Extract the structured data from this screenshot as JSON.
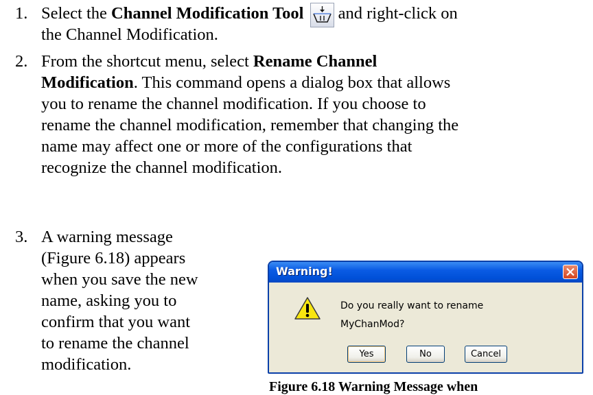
{
  "steps": [
    {
      "number": "1.",
      "pre": "Select the ",
      "bold": "Channel Modification Tool",
      "post": " and right-click on",
      "line2": "the Channel Modification.",
      "icon": "channel-modification-tool-icon"
    },
    {
      "number": "2.",
      "pre": "From the shortcut menu, select ",
      "bold1": "Rename Channel",
      "bold2": "Modification",
      "post2": ".  This command opens a dialog box that allows",
      "line3": "you to rename the channel modification.  If you choose to",
      "line4": "rename the channel modification, remember that changing the",
      "line5": "name may affect one or more of the configurations that",
      "line6": "recognize the channel modification."
    },
    {
      "number": "3.",
      "lines": [
        "A warning message",
        "(Figure 6.18) appears",
        "when you save the new",
        "name, asking you to",
        "confirm that you want",
        "to rename the channel",
        "modification."
      ]
    }
  ],
  "dialog": {
    "title": "Warning!",
    "message_line1": "Do you really want to rename",
    "message_line2": "MyChanMod?",
    "buttons": {
      "yes": "Yes",
      "no": "No",
      "cancel": "Cancel"
    },
    "icon": "warning-icon",
    "close_icon": "close-icon"
  },
  "caption": "Figure 6.18  Warning Message when",
  "colors": {
    "titlebar": "#0a5be4",
    "dialog_bg": "#ece9d8",
    "close_button": "#d6451f"
  }
}
